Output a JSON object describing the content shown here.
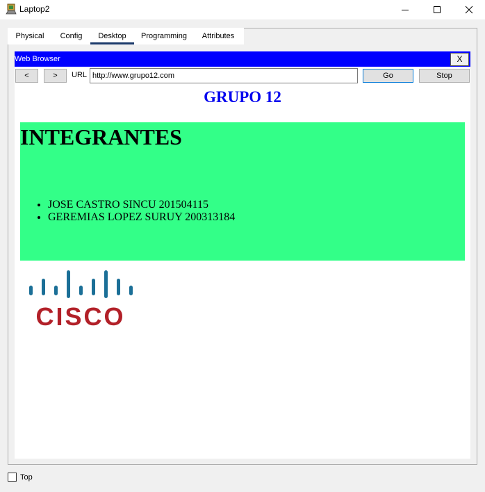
{
  "window": {
    "title": "Laptop2",
    "icon": "laptop-app-icon",
    "controls": [
      "minimize-icon",
      "maximize-icon",
      "close-icon"
    ]
  },
  "tabs": [
    {
      "label": "Physical"
    },
    {
      "label": "Config"
    },
    {
      "label": "Desktop",
      "active": true
    },
    {
      "label": "Programming"
    },
    {
      "label": "Attributes"
    }
  ],
  "browser": {
    "title": "Web Browser",
    "close_label": "X",
    "header_color": "#0000ff",
    "back_label": "<",
    "forward_label": ">",
    "url_label": "URL",
    "url_value": "http://www.grupo12.com",
    "go_label": "Go",
    "stop_label": "Stop"
  },
  "page": {
    "heading": "GRUPO 12",
    "heading_color": "#0000ee",
    "section_title": "INTEGRANTES",
    "section_bg": "#33ff88",
    "members": [
      "JOSE CASTRO SINCU 201504115",
      "GEREMIAS LOPEZ SURUY 200313184"
    ],
    "logo": {
      "text": "CISCO",
      "bar_color": "#1b6f97",
      "text_color": "#b22028"
    }
  },
  "footer": {
    "top_label": "Top",
    "top_checked": false
  }
}
